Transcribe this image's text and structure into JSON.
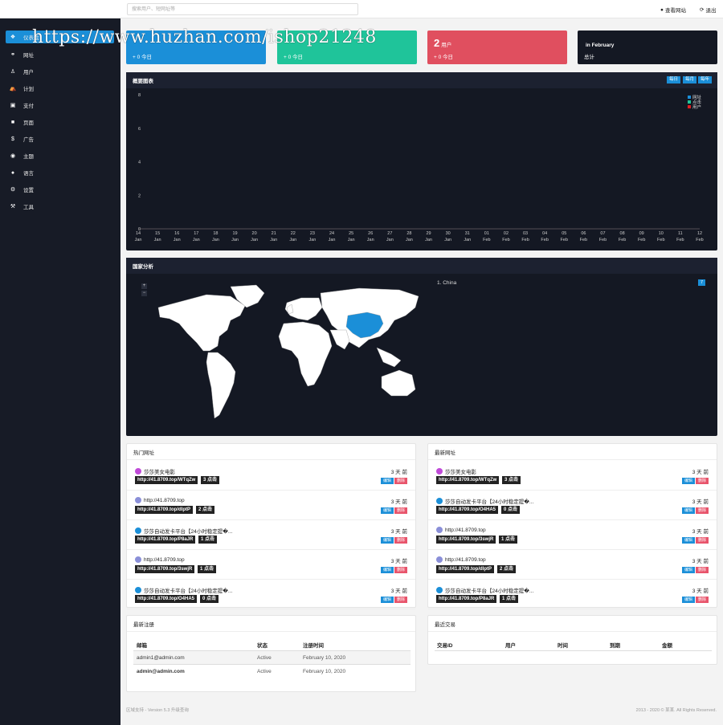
{
  "topbar": {
    "search_placeholder": "搜索用户、短网址等",
    "view_site": "查看网站",
    "logout": "退出"
  },
  "watermark": "https://www.huzhan.com/ishop21248",
  "sidebar": {
    "items": [
      {
        "label": "仪表盘",
        "icon": "dashboard-icon"
      },
      {
        "label": "网址",
        "icon": "link-icon"
      },
      {
        "label": "用户",
        "icon": "user-icon"
      },
      {
        "label": "计划",
        "icon": "bank-icon"
      },
      {
        "label": "支付",
        "icon": "card-icon"
      },
      {
        "label": "页面",
        "icon": "page-icon"
      },
      {
        "label": "广告",
        "icon": "dollar-icon"
      },
      {
        "label": "主题",
        "icon": "eye-icon"
      },
      {
        "label": "语言",
        "icon": "globe-icon"
      },
      {
        "label": "设置",
        "icon": "gear-icon"
      },
      {
        "label": "工具",
        "icon": "wrench-icon"
      }
    ]
  },
  "stats": [
    {
      "big": "",
      "label": "",
      "sub": "+ 0 今日",
      "color": "#1b8fd8"
    },
    {
      "big": "",
      "label": "",
      "sub": "+ 0 今日",
      "color": "#1fc49a"
    },
    {
      "big": "2",
      "label": "用户",
      "sub": "+ 0 今日",
      "color": "#e04f5f"
    },
    {
      "big": "",
      "label": "in February",
      "sub": "总计",
      "color": "#141823"
    }
  ],
  "overview": {
    "title": "概要图表",
    "buttons": [
      "每日",
      "每月",
      "每年"
    ]
  },
  "chart_data": {
    "type": "line",
    "title": "",
    "ylim": [
      0,
      8
    ],
    "yticks": [
      "0",
      "2",
      "4",
      "6",
      "8"
    ],
    "categories": [
      "14 Jan",
      "15 Jan",
      "16 Jan",
      "17 Jan",
      "18 Jan",
      "19 Jan",
      "20 Jan",
      "21 Jan",
      "22 Jan",
      "23 Jan",
      "24 Jan",
      "25 Jan",
      "26 Jan",
      "27 Jan",
      "28 Jan",
      "29 Jan",
      "30 Jan",
      "31 Jan",
      "01 Feb",
      "02 Feb",
      "03 Feb",
      "04 Feb",
      "05 Feb",
      "06 Feb",
      "07 Feb",
      "08 Feb",
      "09 Feb",
      "10 Feb",
      "11 Feb",
      "12 Feb"
    ],
    "tick_day": [
      "14",
      "15",
      "16",
      "17",
      "18",
      "19",
      "20",
      "21",
      "22",
      "23",
      "24",
      "25",
      "26",
      "27",
      "28",
      "29",
      "30",
      "31",
      "01",
      "02",
      "03",
      "04",
      "05",
      "06",
      "07",
      "08",
      "09",
      "10",
      "11",
      "12"
    ],
    "tick_month": [
      "Jan",
      "Jan",
      "Jan",
      "Jan",
      "Jan",
      "Jan",
      "Jan",
      "Jan",
      "Jan",
      "Jan",
      "Jan",
      "Jan",
      "Jan",
      "Jan",
      "Jan",
      "Jan",
      "Jan",
      "Jan",
      "Feb",
      "Feb",
      "Feb",
      "Feb",
      "Feb",
      "Feb",
      "Feb",
      "Feb",
      "Feb",
      "Feb",
      "Feb",
      "Feb"
    ],
    "series": [
      {
        "name": "网址",
        "color": "#1b8fd8",
        "values": [
          0,
          0,
          0,
          0,
          0,
          0,
          0,
          0,
          0,
          0,
          0,
          0,
          0,
          0,
          0,
          0,
          0,
          0,
          0,
          0,
          0,
          0,
          0,
          0,
          0,
          0,
          0,
          0,
          0,
          0
        ]
      },
      {
        "name": "点击",
        "color": "#1fc49a",
        "values": [
          0,
          0,
          0,
          0,
          0,
          0,
          0,
          0,
          0,
          0,
          0,
          0,
          0,
          0,
          0,
          0,
          0,
          0,
          0,
          0,
          0,
          0,
          0,
          0,
          0,
          0,
          0,
          0,
          0,
          0
        ]
      },
      {
        "name": "用户",
        "color": "#e02020",
        "values": [
          0,
          0,
          0,
          0,
          0,
          0,
          0,
          0,
          0,
          0,
          0,
          0,
          0,
          0,
          0,
          0,
          0,
          0,
          0,
          0,
          0,
          0,
          0,
          0,
          0,
          0,
          0,
          0,
          0,
          0
        ]
      }
    ],
    "legend": "top-right"
  },
  "country": {
    "title": "国家分析",
    "zoom_in": "+",
    "zoom_out": "−",
    "top": [
      {
        "name": "1. China",
        "count": "7"
      }
    ],
    "highlight_color": "#1b8fd8"
  },
  "popular": {
    "title": "热门网址",
    "edit": "编辑",
    "delete": "删除",
    "rows": [
      {
        "title": "莎莎美女电影",
        "age": "3 天 前",
        "url": "http://41.8709.top/WTqZw",
        "clicks": "3 点击",
        "fav": "#c04ad8"
      },
      {
        "title": "http://41.8709.top",
        "age": "3 天 前",
        "url": "http://41.8709.top/dlptP",
        "clicks": "2 点击",
        "fav": "#8a8fd8"
      },
      {
        "title": "莎莎自动发卡平台【24小时稳定提�...",
        "age": "3 天 前",
        "url": "http://41.8709.top/P8aJR",
        "clicks": "1 点击",
        "fav": "#1b8fd8"
      },
      {
        "title": "http://41.8709.top",
        "age": "3 天 前",
        "url": "http://41.8709.top/3swjR",
        "clicks": "1 点击",
        "fav": "#8a8fd8"
      },
      {
        "title": "莎莎自动发卡平台【24小时稳定提�...",
        "age": "3 天 前",
        "url": "http://41.8709.top/O4HA5",
        "clicks": "0 点击",
        "fav": "#1b8fd8"
      }
    ]
  },
  "latest": {
    "title": "最新网址",
    "edit": "编辑",
    "delete": "删除",
    "rows": [
      {
        "title": "莎莎美女电影",
        "age": "3 天 前",
        "url": "http://41.8709.top/WTqZw",
        "clicks": "3 点击",
        "fav": "#c04ad8"
      },
      {
        "title": "莎莎自动发卡平台【24小时稳定提�...",
        "age": "3 天 前",
        "url": "http://41.8709.top/O4HA5",
        "clicks": "0 点击",
        "fav": "#1b8fd8"
      },
      {
        "title": "http://41.8709.top",
        "age": "3 天 前",
        "url": "http://41.8709.top/3swjR",
        "clicks": "1 点击",
        "fav": "#8a8fd8"
      },
      {
        "title": "http://41.8709.top",
        "age": "3 天 前",
        "url": "http://41.8709.top/dlptP",
        "clicks": "2 点击",
        "fav": "#8a8fd8"
      },
      {
        "title": "莎莎自动发卡平台【24小时稳定提�...",
        "age": "3 天 前",
        "url": "http://41.8709.top/P8aJR",
        "clicks": "1 点击",
        "fav": "#1b8fd8"
      }
    ]
  },
  "registrations": {
    "title": "最新注册",
    "headers": [
      "邮箱",
      "状态",
      "注册时间"
    ],
    "rows": [
      {
        "email": "admin1@admin.com",
        "status": "Active",
        "date": "February 10, 2020"
      },
      {
        "email": "admin@admin.com",
        "status": "Active",
        "date": "February 10, 2020"
      }
    ]
  },
  "transactions": {
    "title": "最近交易",
    "headers": [
      "交易ID",
      "用户",
      "时间",
      "到期",
      "金额"
    ]
  },
  "footer": {
    "left": "区域支持 - Version 5.3 升级查询",
    "right": "2013 - 2020 © 某某. All Rights Reserved."
  }
}
